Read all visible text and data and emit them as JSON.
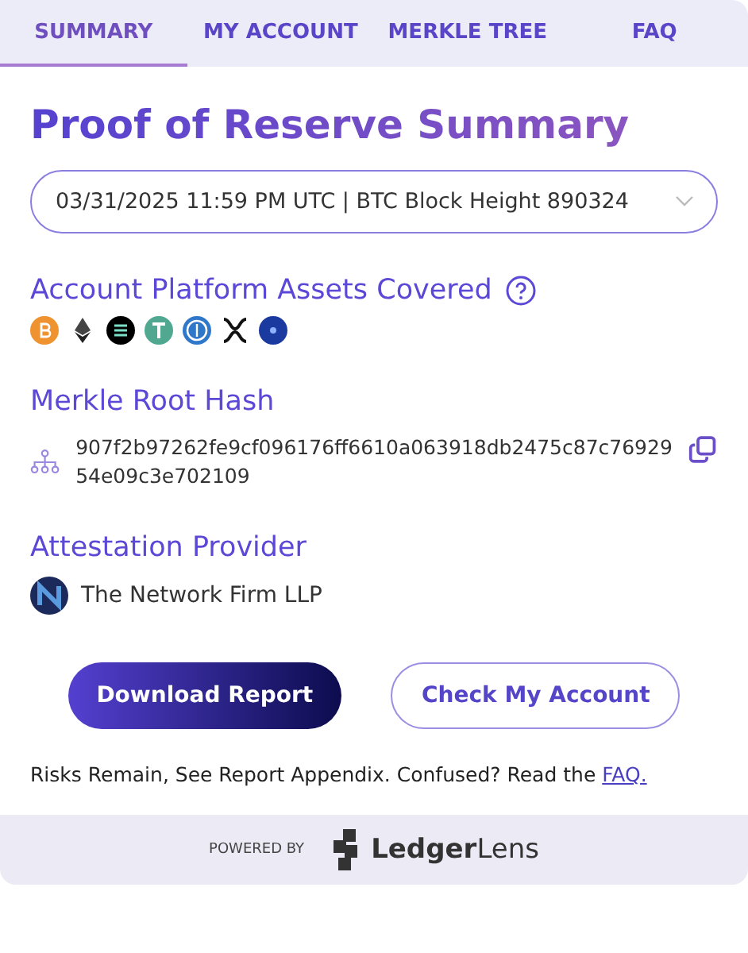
{
  "tabs": [
    {
      "label": "SUMMARY",
      "selected": true
    },
    {
      "label": "MY ACCOUNT",
      "selected": false
    },
    {
      "label": "MERKLE TREE",
      "selected": false
    },
    {
      "label": "FAQ",
      "selected": false
    }
  ],
  "title": "Proof of Reserve Summary",
  "snapshot_select": {
    "value": "03/31/2025 11:59 PM UTC | BTC Block Height 890324"
  },
  "assets_section": {
    "heading": "Account Platform Assets Covered"
  },
  "merkle_section": {
    "heading": "Merkle Root Hash",
    "hash_lines": [
      "907f2b97262fe9cf096176ff6610a063918db2475c87c76929",
      "54e09c3e702109"
    ]
  },
  "attestation_section": {
    "heading": "Attestation Provider",
    "provider": "The Network Firm LLP"
  },
  "buttons": [
    {
      "label": "Download Report",
      "kind": "primary"
    },
    {
      "label": "Check My Account",
      "kind": "outline"
    }
  ],
  "notice": {
    "text": "Risks Remain, See Report Appendix. Confused? Read the",
    "link": "FAQ."
  },
  "footer": {
    "powered_by": "POWERED BY",
    "brand": "**Ledger**Lens"
  }
}
